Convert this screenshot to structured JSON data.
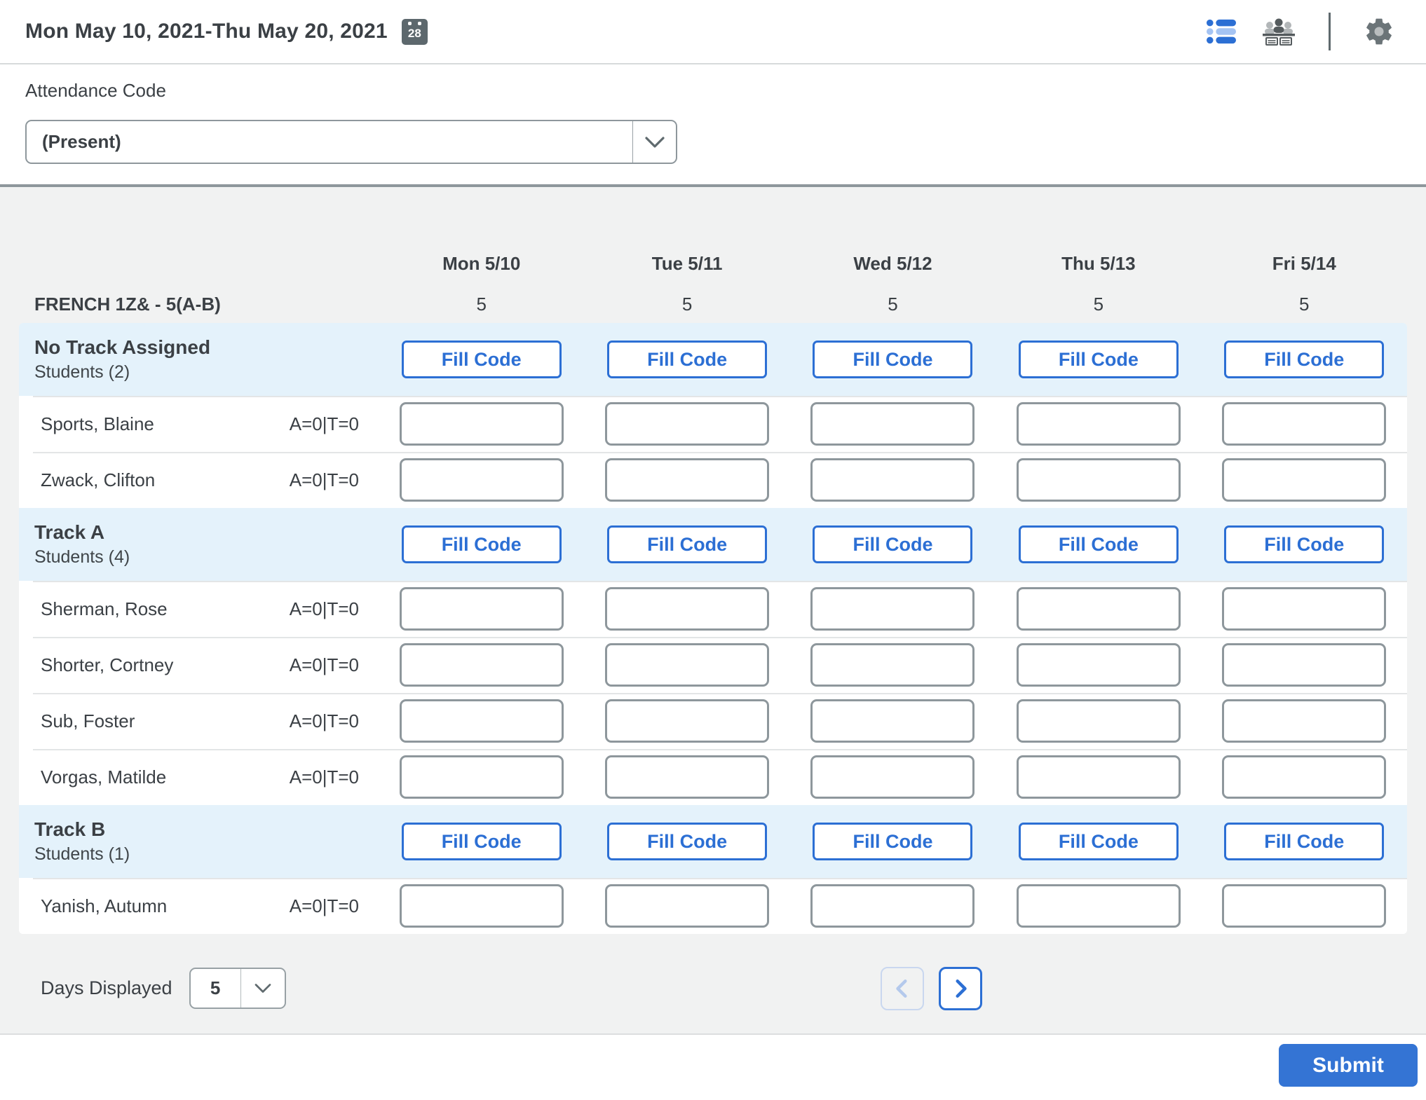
{
  "header": {
    "date_range": "Mon May 10, 2021-Thu May 20, 2021",
    "calendar_day": "28"
  },
  "attendance_code": {
    "label": "Attendance Code",
    "value": "(Present)"
  },
  "table": {
    "class_name": "FRENCH 1Z& - 5(A-B)",
    "days": [
      "Mon 5/10",
      "Tue 5/11",
      "Wed 5/12",
      "Thu 5/13",
      "Fri 5/14"
    ],
    "periods": [
      "5",
      "5",
      "5",
      "5",
      "5"
    ],
    "fill_code_label": "Fill Code",
    "groups": [
      {
        "name": "No Track Assigned",
        "students_label": "Students (2)",
        "students": [
          {
            "name": "Sports, Blaine",
            "tally": "A=0|T=0",
            "values": [
              "",
              "",
              "",
              "",
              ""
            ]
          },
          {
            "name": "Zwack, Clifton",
            "tally": "A=0|T=0",
            "values": [
              "",
              "",
              "",
              "",
              ""
            ]
          }
        ]
      },
      {
        "name": "Track A",
        "students_label": "Students (4)",
        "students": [
          {
            "name": "Sherman, Rose",
            "tally": "A=0|T=0",
            "values": [
              "",
              "",
              "",
              "",
              ""
            ]
          },
          {
            "name": "Shorter, Cortney",
            "tally": "A=0|T=0",
            "values": [
              "",
              "",
              "",
              "",
              ""
            ]
          },
          {
            "name": "Sub, Foster",
            "tally": "A=0|T=0",
            "values": [
              "",
              "",
              "",
              "",
              ""
            ]
          },
          {
            "name": "Vorgas, Matilde",
            "tally": "A=0|T=0",
            "values": [
              "",
              "",
              "",
              "",
              ""
            ]
          }
        ]
      },
      {
        "name": "Track B",
        "students_label": "Students (1)",
        "students": [
          {
            "name": "Yanish, Autumn",
            "tally": "A=0|T=0",
            "values": [
              "",
              "",
              "",
              "",
              ""
            ]
          }
        ]
      }
    ]
  },
  "footer_controls": {
    "days_displayed_label": "Days Displayed",
    "days_displayed_value": "5"
  },
  "submit": {
    "label": "Submit"
  },
  "colors": {
    "accent_blue": "#2c6fd4",
    "group_row_bg": "#e4f2fb",
    "page_gray": "#f1f2f2",
    "input_border": "#8e979c"
  }
}
